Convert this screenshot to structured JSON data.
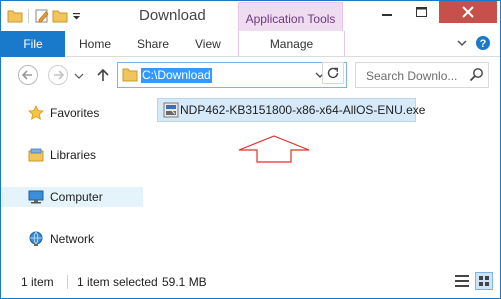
{
  "window": {
    "title": "Download",
    "context_tab": "Application Tools"
  },
  "ribbon": {
    "file": "File",
    "tabs": [
      "Home",
      "Share",
      "View"
    ],
    "manage": "Manage"
  },
  "address": {
    "path": "C:\\Download",
    "search_placeholder": "Search Downlo..."
  },
  "nav": {
    "items": [
      {
        "label": "Favorites",
        "icon": "star-icon"
      },
      {
        "label": "Libraries",
        "icon": "libraries-icon"
      },
      {
        "label": "Computer",
        "icon": "computer-icon",
        "selected": true
      },
      {
        "label": "Network",
        "icon": "network-icon"
      }
    ]
  },
  "files": [
    {
      "name": "NDP462-KB3151800-x86-x64-AllOS-ENU.exe",
      "icon": "installer-icon",
      "selected": true
    }
  ],
  "annotation": {
    "shape": "outlined-up-arrow",
    "color": "#e03030"
  },
  "status": {
    "count": "1 item",
    "selection": "1 item selected",
    "size": "59.1 MB"
  },
  "colors": {
    "accent": "#1979ca",
    "close": "#c7504b",
    "context_tab": "#f0dcf0",
    "selection": "#d5e9f9"
  }
}
